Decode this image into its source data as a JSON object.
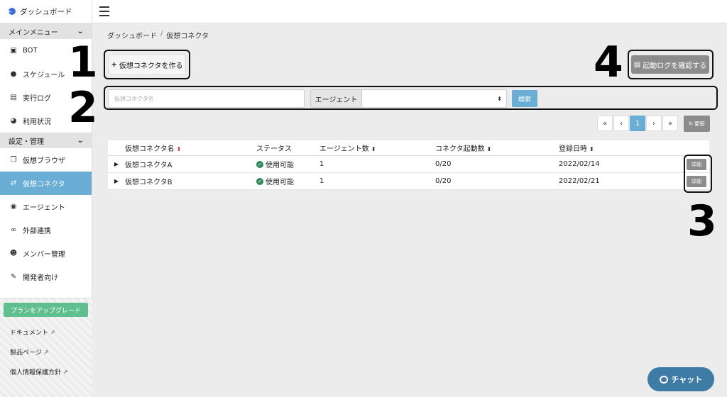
{
  "sidebar": {
    "brand": "ダッシュボード",
    "section_main": "メインメニュー",
    "main_items": [
      {
        "label": "BOT",
        "icon": "robot-icon"
      },
      {
        "label": "スケジュール",
        "icon": "clock-icon"
      },
      {
        "label": "実行ログ",
        "icon": "file-icon"
      },
      {
        "label": "利用状況",
        "icon": "pie-chart-icon"
      }
    ],
    "section_settings": "設定・管理",
    "settings_items": [
      {
        "label": "仮想ブラウザ",
        "icon": "browser-icon"
      },
      {
        "label": "仮想コネクタ",
        "icon": "connector-icon",
        "active": true
      },
      {
        "label": "エージェント",
        "icon": "chrome-icon"
      },
      {
        "label": "外部連携",
        "icon": "link-icon"
      },
      {
        "label": "メンバー管理",
        "icon": "users-icon"
      },
      {
        "label": "開発者向け",
        "icon": "wrench-icon"
      }
    ],
    "upgrade_label": "プランをアップグレード",
    "links": [
      "ドキュメント",
      "製品ページ",
      "個人情報保護方針"
    ]
  },
  "breadcrumb": [
    "ダッシュボード",
    "仮想コネクタ"
  ],
  "create_button": "仮想コネクタを作る",
  "log_button": "起動ログを確認する",
  "search": {
    "name_placeholder": "仮想コネクタ名",
    "agent_label": "エージェント",
    "search_button": "検索"
  },
  "pagination": {
    "first": "«",
    "prev": "‹",
    "current": "1",
    "next": "›",
    "last": "»"
  },
  "refresh_label": "更新",
  "table": {
    "headers": [
      "仮想コネクタ名",
      "ステータス",
      "エージェント数",
      "コネクタ起動数",
      "登録日時"
    ],
    "rows": [
      {
        "name": "仮想コネクタA",
        "status": "使用可能",
        "agents": "1",
        "launches": "0/20",
        "date": "2022/02/14",
        "action": "詳細"
      },
      {
        "name": "仮想コネクタB",
        "status": "使用可能",
        "agents": "1",
        "launches": "0/20",
        "date": "2022/02/21",
        "action": "詳細"
      }
    ]
  },
  "callouts": [
    "1",
    "2",
    "3",
    "4"
  ],
  "chat_label": "チャット"
}
